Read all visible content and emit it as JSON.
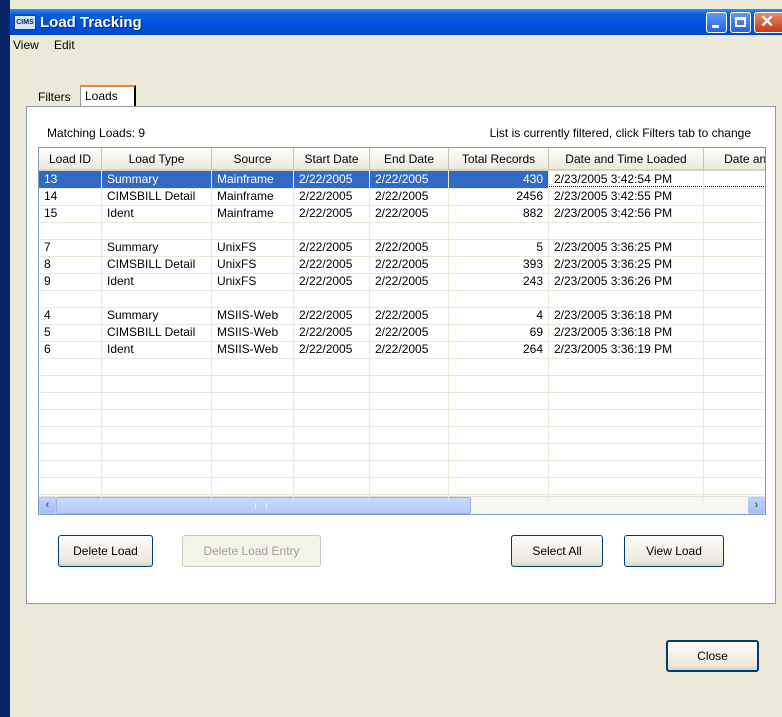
{
  "window": {
    "title": "Load Tracking",
    "app_icon_text": "CIMS"
  },
  "menu": {
    "items": [
      "View",
      "Edit"
    ]
  },
  "tabs": [
    {
      "label": "Filters",
      "active": false
    },
    {
      "label": "Loads",
      "active": true
    }
  ],
  "loads_panel": {
    "matching_label": "Matching Loads: 9",
    "filter_note": "List is currently filtered, click Filters tab to change",
    "columns": [
      "Load ID",
      "Load Type",
      "Source",
      "Start Date",
      "End Date",
      "Total Records",
      "Date and Time Loaded",
      "Date and"
    ],
    "rows": [
      {
        "id": "13",
        "type": "Summary",
        "source": "Mainframe",
        "start": "2/22/2005",
        "end": "2/22/2005",
        "records": "430",
        "loaded": "2/23/2005 3:42:54 PM",
        "selected": true
      },
      {
        "id": "14",
        "type": "CIMSBILL Detail",
        "source": "Mainframe",
        "start": "2/22/2005",
        "end": "2/22/2005",
        "records": "2456",
        "loaded": "2/23/2005 3:42:55 PM"
      },
      {
        "id": "15",
        "type": "Ident",
        "source": "Mainframe",
        "start": "2/22/2005",
        "end": "2/22/2005",
        "records": "882",
        "loaded": "2/23/2005 3:42:56 PM"
      },
      null,
      {
        "id": "7",
        "type": "Summary",
        "source": "UnixFS",
        "start": "2/22/2005",
        "end": "2/22/2005",
        "records": "5",
        "loaded": "2/23/2005 3:36:25 PM"
      },
      {
        "id": "8",
        "type": "CIMSBILL Detail",
        "source": "UnixFS",
        "start": "2/22/2005",
        "end": "2/22/2005",
        "records": "393",
        "loaded": "2/23/2005 3:36:25 PM"
      },
      {
        "id": "9",
        "type": "Ident",
        "source": "UnixFS",
        "start": "2/22/2005",
        "end": "2/22/2005",
        "records": "243",
        "loaded": "2/23/2005 3:36:26 PM"
      },
      null,
      {
        "id": "4",
        "type": "Summary",
        "source": "MSIIS-Web",
        "start": "2/22/2005",
        "end": "2/22/2005",
        "records": "4",
        "loaded": "2/23/2005 3:36:18 PM"
      },
      {
        "id": "5",
        "type": "CIMSBILL Detail",
        "source": "MSIIS-Web",
        "start": "2/22/2005",
        "end": "2/22/2005",
        "records": "69",
        "loaded": "2/23/2005 3:36:18 PM"
      },
      {
        "id": "6",
        "type": "Ident",
        "source": "MSIIS-Web",
        "start": "2/22/2005",
        "end": "2/22/2005",
        "records": "264",
        "loaded": "2/23/2005 3:36:19 PM"
      }
    ],
    "scrollbar_thumb_fraction": 0.6
  },
  "buttons": {
    "delete_load": "Delete Load",
    "delete_load_entry": "Delete Load Entry",
    "select_all": "Select All",
    "view_load": "View Load",
    "close": "Close"
  },
  "colors": {
    "selection": "#316ac5",
    "title_bar": "#0054e3",
    "window_bg": "#ece9d8"
  }
}
